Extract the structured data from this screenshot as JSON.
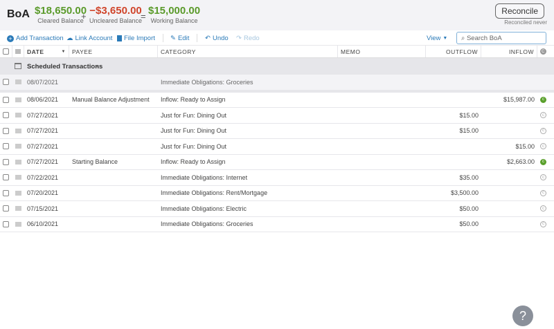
{
  "header": {
    "account": "BoA",
    "cleared": "$18,650.00",
    "cleared_label": "Cleared Balance",
    "plus": "+",
    "uncleared": "−$3,650.00",
    "uncleared_label": "Uncleared Balance",
    "equals": "=",
    "working": "$15,000.00",
    "working_label": "Working Balance",
    "reconcile": "Reconcile",
    "reconciled_note": "Reconciled never"
  },
  "toolbar": {
    "add": "Add Transaction",
    "link": "Link Account",
    "import": "File Import",
    "edit": "Edit",
    "undo": "Undo",
    "redo": "Redo",
    "view": "View",
    "search_placeholder": "Search BoA"
  },
  "columns": {
    "date": "DATE",
    "payee": "PAYEE",
    "category": "CATEGORY",
    "memo": "MEMO",
    "outflow": "OUTFLOW",
    "inflow": "INFLOW"
  },
  "scheduled": {
    "label": "Scheduled Transactions",
    "rows": [
      {
        "date": "08/07/2021",
        "payee": "",
        "category": "Immediate Obligations: Groceries",
        "outflow": "",
        "inflow": ""
      }
    ]
  },
  "transactions": [
    {
      "date": "08/06/2021",
      "payee": "Manual Balance Adjustment",
      "category": "Inflow: Ready to Assign",
      "outflow": "",
      "inflow": "$15,987.00",
      "cleared": true
    },
    {
      "date": "07/27/2021",
      "payee": "",
      "category": "Just for Fun: Dining Out",
      "outflow": "$15.00",
      "inflow": "",
      "cleared": false
    },
    {
      "date": "07/27/2021",
      "payee": "",
      "category": "Just for Fun: Dining Out",
      "outflow": "$15.00",
      "inflow": "",
      "cleared": false
    },
    {
      "date": "07/27/2021",
      "payee": "",
      "category": "Just for Fun: Dining Out",
      "outflow": "",
      "inflow": "$15.00",
      "cleared": false
    },
    {
      "date": "07/27/2021",
      "payee": "Starting Balance",
      "category": "Inflow: Ready to Assign",
      "outflow": "",
      "inflow": "$2,663.00",
      "cleared": true
    },
    {
      "date": "07/22/2021",
      "payee": "",
      "category": "Immediate Obligations: Internet",
      "outflow": "$35.00",
      "inflow": "",
      "cleared": false
    },
    {
      "date": "07/20/2021",
      "payee": "",
      "category": "Immediate Obligations: Rent/Mortgage",
      "outflow": "$3,500.00",
      "inflow": "",
      "cleared": false
    },
    {
      "date": "07/15/2021",
      "payee": "",
      "category": "Immediate Obligations: Electric",
      "outflow": "$50.00",
      "inflow": "",
      "cleared": false
    },
    {
      "date": "06/10/2021",
      "payee": "",
      "category": "Immediate Obligations: Groceries",
      "outflow": "$50.00",
      "inflow": "",
      "cleared": false
    }
  ],
  "help": "?",
  "colors": {
    "positive": "#5a9a2a",
    "negative": "#d0452b",
    "accent": "#2a7ab8"
  }
}
